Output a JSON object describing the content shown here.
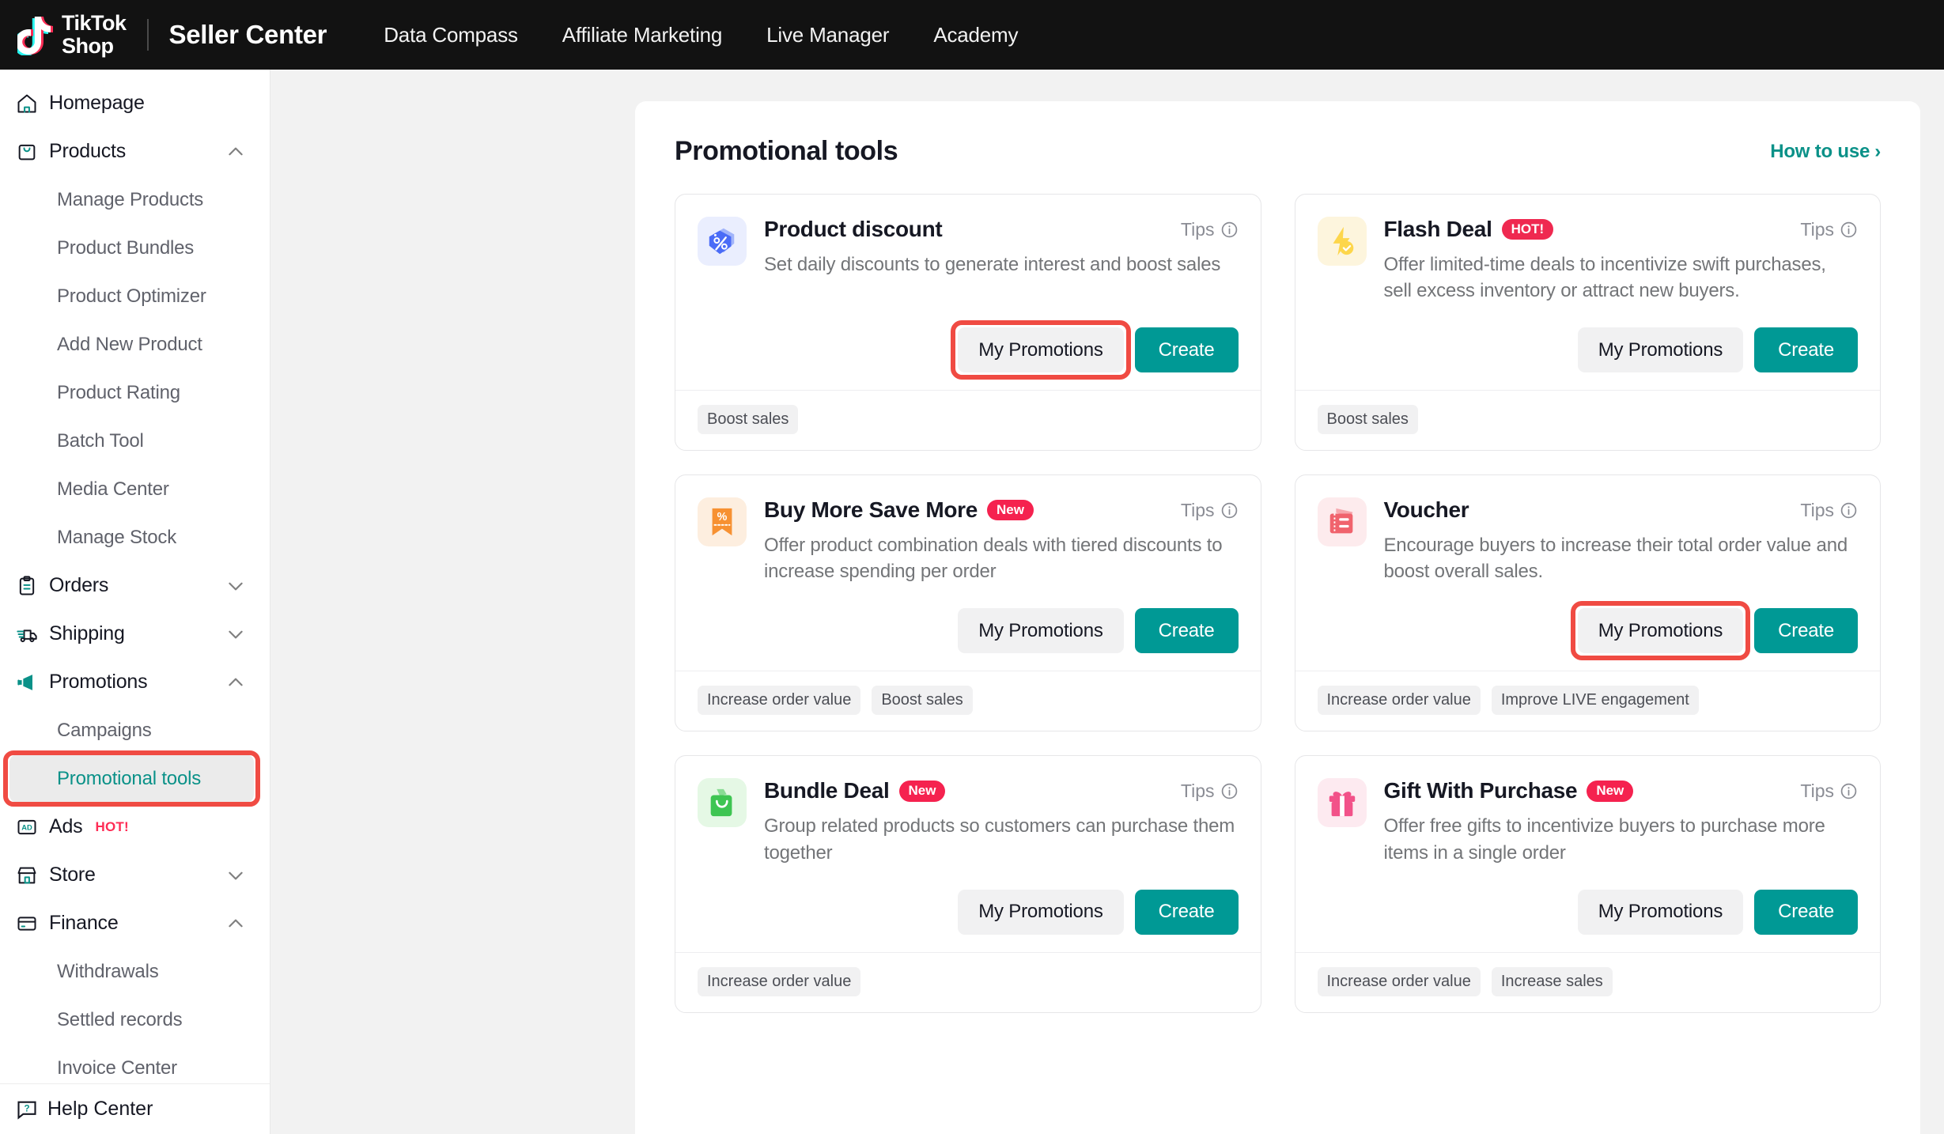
{
  "topbar": {
    "brand_line1": "TikTok",
    "brand_line2": "Shop",
    "seller_center": "Seller Center",
    "nav": [
      {
        "label": "Data Compass"
      },
      {
        "label": "Affiliate Marketing"
      },
      {
        "label": "Live Manager"
      },
      {
        "label": "Academy"
      }
    ]
  },
  "sidebar": {
    "items": [
      {
        "label": "Homepage",
        "icon": "home-icon",
        "type": "top",
        "chevron": "none"
      },
      {
        "label": "Products",
        "icon": "bag-icon",
        "type": "top",
        "chevron": "up"
      },
      {
        "label": "Manage Products",
        "type": "sub"
      },
      {
        "label": "Product Bundles",
        "type": "sub"
      },
      {
        "label": "Product Optimizer",
        "type": "sub"
      },
      {
        "label": "Add New Product",
        "type": "sub"
      },
      {
        "label": "Product Rating",
        "type": "sub"
      },
      {
        "label": "Batch Tool",
        "type": "sub"
      },
      {
        "label": "Media Center",
        "type": "sub"
      },
      {
        "label": "Manage Stock",
        "type": "sub"
      },
      {
        "label": "Orders",
        "icon": "clipboard-icon",
        "type": "top",
        "chevron": "down"
      },
      {
        "label": "Shipping",
        "icon": "truck-icon",
        "type": "top",
        "chevron": "down"
      },
      {
        "label": "Promotions",
        "icon": "megaphone-icon",
        "type": "top",
        "chevron": "up"
      },
      {
        "label": "Campaigns",
        "type": "sub"
      },
      {
        "label": "Promotional tools",
        "type": "sub",
        "active": true
      },
      {
        "label": "Ads",
        "icon": "ad-icon",
        "type": "top",
        "chevron": "none",
        "hot": "HOT!"
      },
      {
        "label": "Store",
        "icon": "store-icon",
        "type": "top",
        "chevron": "down"
      },
      {
        "label": "Finance",
        "icon": "card-icon",
        "type": "top",
        "chevron": "up"
      },
      {
        "label": "Withdrawals",
        "type": "sub"
      },
      {
        "label": "Settled records",
        "type": "sub"
      },
      {
        "label": "Invoice Center",
        "type": "sub"
      }
    ],
    "help_center": "Help Center",
    "help_icon": "help-chat-icon"
  },
  "main": {
    "title": "Promotional tools",
    "how_to_use": "How to use",
    "chevron_right": "›",
    "tips_label": "Tips",
    "my_promotions_label": "My Promotions",
    "create_label": "Create",
    "cards": [
      {
        "title": "Product discount",
        "badge": null,
        "badge_type": null,
        "icon": "price-tag-percent-icon",
        "icon_bg": "#eaeefe",
        "icon_color": "#4a6cf7",
        "desc": "Set daily discounts to generate interest and boost sales",
        "tags": [
          "Boost sales"
        ],
        "highlight_my_promotions": true
      },
      {
        "title": "Flash Deal",
        "badge": "HOT!",
        "badge_type": "hot",
        "icon": "lightning-check-icon",
        "icon_bg": "#fdf5dd",
        "icon_color": "#fdd64b",
        "desc": "Offer limited-time deals to incentivize swift purchases, sell excess inventory or attract new buyers.",
        "tags": [
          "Boost sales"
        ],
        "highlight_my_promotions": false
      },
      {
        "title": "Buy More Save More",
        "badge": "New",
        "badge_type": "new",
        "icon": "ribbon-percent-icon",
        "icon_bg": "#fdeedf",
        "icon_color": "#f79132",
        "desc": "Offer product combination deals with tiered discounts to increase spending per order",
        "tags": [
          "Increase order value",
          "Boost sales"
        ],
        "highlight_my_promotions": false
      },
      {
        "title": "Voucher",
        "badge": null,
        "badge_type": null,
        "icon": "ticket-icon",
        "icon_bg": "#fdebed",
        "icon_color": "#f0636d",
        "desc": "Encourage buyers to increase their total order value and boost overall sales.",
        "tags": [
          "Increase order value",
          "Improve LIVE engagement"
        ],
        "highlight_my_promotions": true
      },
      {
        "title": "Bundle Deal",
        "badge": "New",
        "badge_type": "new",
        "icon": "shopping-bag-icon",
        "icon_bg": "#e5f8e5",
        "icon_color": "#3ec552",
        "desc": "Group related products so customers can purchase them together",
        "tags": [
          "Increase order value"
        ],
        "highlight_my_promotions": false
      },
      {
        "title": "Gift With Purchase",
        "badge": "New",
        "badge_type": "new",
        "icon": "gift-box-icon",
        "icon_bg": "#fdeaf0",
        "icon_color": "#f25289",
        "desc": "Offer free gifts to incentivize buyers to purchase more items in a single order",
        "tags": [
          "Increase order value",
          "Increase sales"
        ],
        "highlight_my_promotions": false
      }
    ]
  },
  "colors": {
    "accent_teal": "#009995",
    "highlight_red": "#f04b43",
    "badge_red": "#f5224f",
    "topbar_bg": "#121212"
  }
}
